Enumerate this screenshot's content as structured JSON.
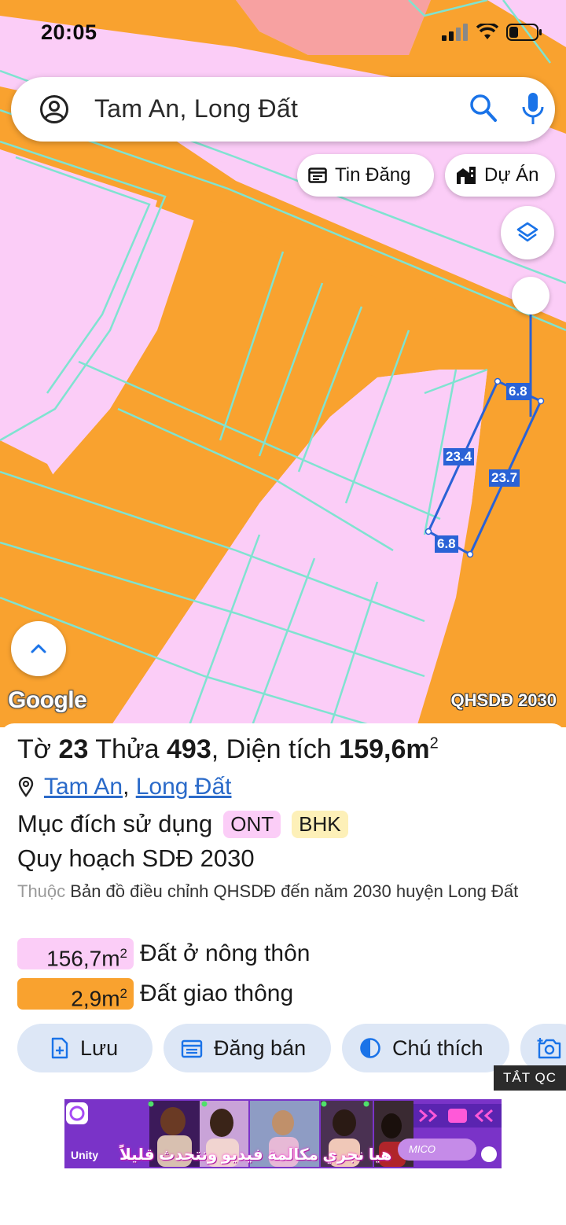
{
  "status_bar": {
    "time": "20:05"
  },
  "search": {
    "query": "Tam An, Long Đất"
  },
  "map_pills": {
    "tin_dang": "Tin Đăng",
    "du_an": "Dự Án"
  },
  "map": {
    "attribution": "Google",
    "source_label": "QHSDĐ 2030",
    "dimensions": {
      "top": "6.8",
      "left": "23.4",
      "right": "23.7",
      "bottom": "6.8"
    },
    "colors": {
      "residential": "#fbcdf7",
      "traffic": "#f9a22f",
      "parcel_line": "#7fe3d0",
      "selection": "#2a62d6",
      "other_zone": "#f7a1a1"
    }
  },
  "parcel": {
    "sheet_label": "Tờ",
    "sheet_no": "23",
    "plot_label": "Thửa",
    "plot_no": "493",
    "area_label": "Diện tích",
    "area_value": "159,6m",
    "area_sup": "2",
    "commune": "Tam An",
    "district": "Long Đất",
    "purpose_label": "Mục đích sử dụng",
    "purpose_tags": [
      "ONT",
      "BHK"
    ],
    "plan_label": "Quy hoạch SDĐ 2030",
    "source_prefix": "Thuộc",
    "source_text": "Bản đồ điều chỉnh QHSDĐ đến năm 2030 huyện Long Đất",
    "areas": [
      {
        "value": "156,7m",
        "sup": "2",
        "label": "Đất ở nông thôn"
      },
      {
        "value": "2,9m",
        "sup": "2",
        "label": "Đất giao thông"
      }
    ]
  },
  "actions": {
    "save": "Lưu",
    "post": "Đăng bán",
    "legend": "Chú thích"
  },
  "ad": {
    "close_label": "TẮT QC",
    "brand": "Unity",
    "caption": "هيا نجري مكالمة فيديو ونتحدث قليلاً",
    "app_name": "MICO"
  }
}
